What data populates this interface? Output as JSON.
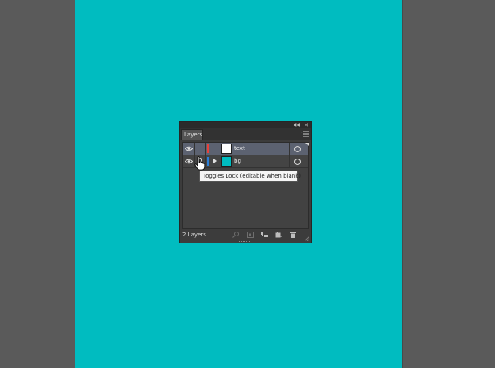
{
  "panel": {
    "title": "Layers",
    "footer_count": "2 Layers"
  },
  "layers": [
    {
      "name": "text",
      "color": "#e8413b",
      "thumb": "#ffffff",
      "selected": true
    },
    {
      "name": "bg",
      "color": "#2a7fd9",
      "thumb": "#00bcc0",
      "selected": false
    }
  ],
  "tooltip": "Toggles Lock (editable when blank)",
  "colors": {
    "canvas": "#00bcc0",
    "workspace": "#5a5a5a",
    "selection": "#5c6271"
  }
}
